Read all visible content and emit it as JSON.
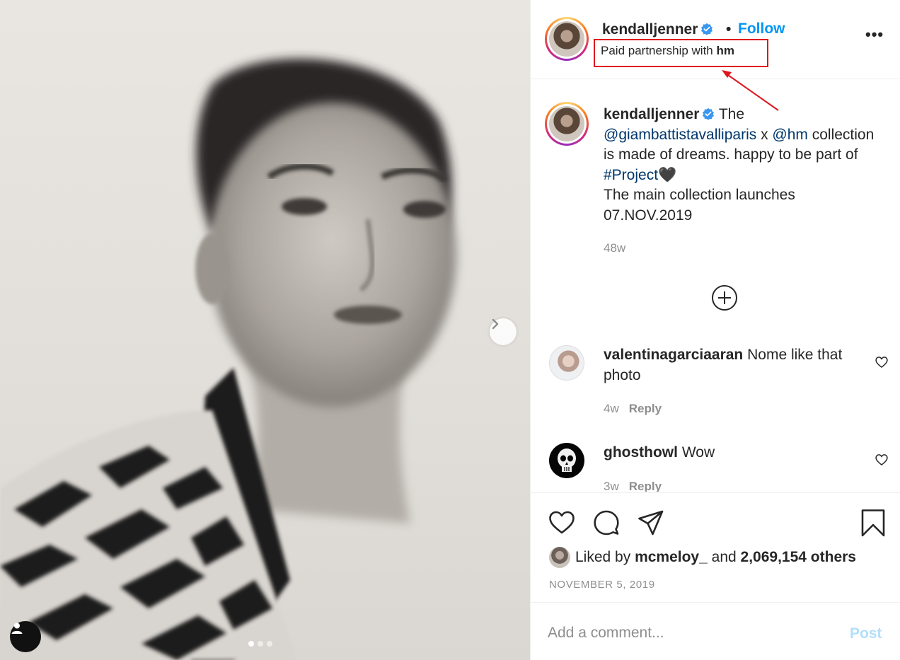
{
  "post": {
    "author": "kendalljenner",
    "follow_label": "Follow",
    "separator": "•",
    "partnership_prefix": "Paid partnership with ",
    "partnership_brand": "hm",
    "more_label": "•••"
  },
  "caption": {
    "author": "kendalljenner",
    "text_1": " The ",
    "mention_1": "@giambattistavalliparis",
    "text_2": " x ",
    "mention_2": "@hm",
    "text_3": " collection is made of dreams. happy to be part of ",
    "hashtag": "#Project",
    "emoji": "🖤",
    "line_2": "The main collection launches 07.NOV.2019",
    "age": "48w"
  },
  "comments": [
    {
      "user": "valentinagarciaaran",
      "text": " Nome like that photo",
      "age": "4w",
      "reply_label": "Reply"
    },
    {
      "user": "ghosthowl",
      "text": " Wow",
      "age": "3w",
      "reply_label": "Reply"
    }
  ],
  "engagement": {
    "liked_by_prefix": "Liked by ",
    "liked_by_user": "mcmeloy_",
    "and_text": " and ",
    "others": "2,069,154 others",
    "date": "NOVEMBER 5, 2019"
  },
  "comment_box": {
    "placeholder": "Add a comment...",
    "post_label": "Post"
  },
  "carousel": {
    "slides": 3,
    "active": 1
  },
  "colors": {
    "accent": "#0095f6",
    "mention": "#00376b",
    "muted": "#8e8e8e",
    "annotation": "#e0141b",
    "post_disabled": "#b2dffc"
  },
  "icons": [
    "chevron-right-icon",
    "user-tag-icon",
    "verified-badge-icon",
    "plus-circle-icon",
    "heart-icon",
    "comment-icon",
    "share-icon",
    "bookmark-icon"
  ]
}
